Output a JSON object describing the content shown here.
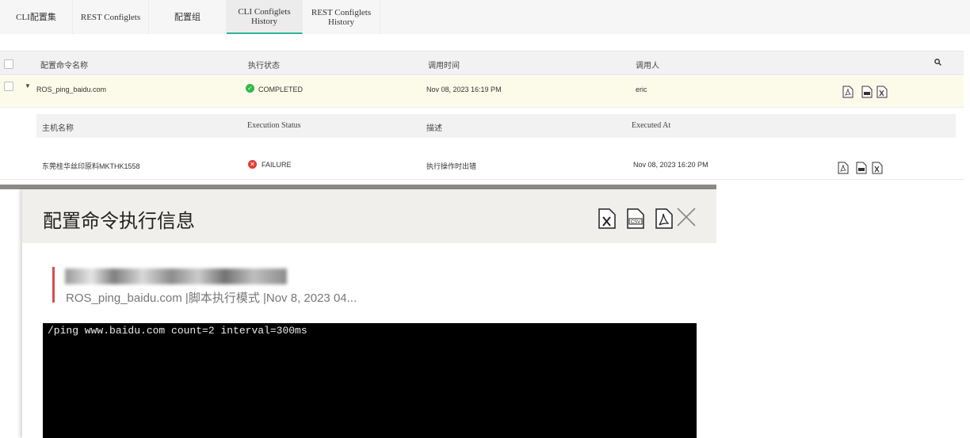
{
  "tabs": [
    {
      "label": "CLI配置集",
      "active": false
    },
    {
      "label": "REST Configlets",
      "active": false
    },
    {
      "label": "配置组",
      "active": false
    },
    {
      "label": "CLI Configlets\nHistory",
      "active": true
    },
    {
      "label": "REST Configlets\nHistory",
      "active": false
    }
  ],
  "table": {
    "headers": {
      "name": "配置命令名称",
      "status": "执行状态",
      "time": "调用时间",
      "user": "调用人"
    },
    "row": {
      "name": "ROS_ping_baidu.com",
      "status": "COMPLETED",
      "time": "Nov 08, 2023 16:19 PM",
      "user": "eric"
    },
    "sub_headers": {
      "host": "主机名称",
      "status": "Execution Status",
      "desc": "描述",
      "executed_at": "Executed At"
    },
    "sub_row": {
      "host": "东莞桂华丝印原料MKTHK1558",
      "status": "FAILURE",
      "desc": "执行操作时出错",
      "executed_at": "Nov 08, 2023 16:20 PM"
    }
  },
  "modal": {
    "title": "配置命令执行信息",
    "meta": "ROS_ping_baidu.com  |脚本执行模式  |Nov 8, 2023 04...",
    "command": "/ping www.baidu.com count=2 interval=300ms"
  },
  "colors": {
    "accent": "#2bb39a",
    "success": "#32b84a",
    "failure": "#e53935",
    "highlight_row": "#fcfbea"
  }
}
